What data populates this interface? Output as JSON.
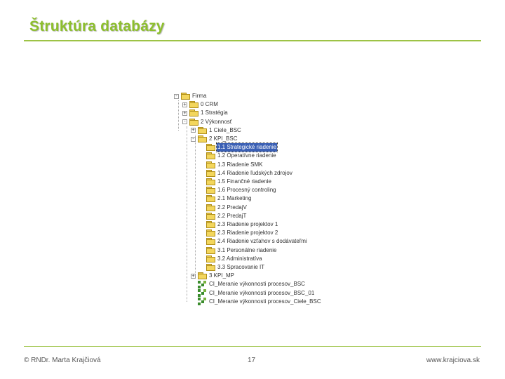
{
  "slide": {
    "title": "Štruktúra databázy",
    "footer_left": "© RNDr. Marta Krajčiová",
    "footer_page": "17",
    "footer_right": "www.krajciova.sk"
  },
  "tree": {
    "items": [
      {
        "label": "Firma",
        "expander": "-",
        "icon": "folder-icon"
      },
      {
        "label": "0 CRM",
        "expander": "+",
        "icon": "folder-icon"
      },
      {
        "label": "1 Stratégia",
        "expander": "+",
        "icon": "folder-icon"
      },
      {
        "label": "2 Výkonnosť",
        "expander": "-",
        "icon": "folder-icon"
      },
      {
        "label": "1 Ciele_BSC",
        "expander": "+",
        "icon": "folder-icon"
      },
      {
        "label": "2 KPI_BSC",
        "expander": "-",
        "icon": "folder-icon"
      },
      {
        "label": "1.1 Strategické riadenie",
        "expander": "",
        "icon": "folder-icon",
        "selected": true
      },
      {
        "label": "1.2 Operatívne riadenie",
        "expander": "",
        "icon": "folder-icon"
      },
      {
        "label": "1.3 Riadenie SMK",
        "expander": "",
        "icon": "folder-icon"
      },
      {
        "label": "1.4 Riadenie ľudských zdrojov",
        "expander": "",
        "icon": "folder-icon"
      },
      {
        "label": "1.5 Finančné riadenie",
        "expander": "",
        "icon": "folder-icon"
      },
      {
        "label": "1.6 Procesný controling",
        "expander": "",
        "icon": "folder-icon"
      },
      {
        "label": "2.1 Marketing",
        "expander": "",
        "icon": "folder-icon"
      },
      {
        "label": "2.2 PredajV",
        "expander": "",
        "icon": "folder-icon"
      },
      {
        "label": "2.2 PredajT",
        "expander": "",
        "icon": "folder-icon"
      },
      {
        "label": "2.3 Riadenie projektov 1",
        "expander": "",
        "icon": "folder-icon"
      },
      {
        "label": "2.3 Riadenie projektov 2",
        "expander": "",
        "icon": "folder-icon"
      },
      {
        "label": "2.4 Riadenie vzťahov s dodávateľmi",
        "expander": "",
        "icon": "folder-icon"
      },
      {
        "label": "3.1 Personálne riadenie",
        "expander": "",
        "icon": "folder-icon"
      },
      {
        "label": "3.2 Administratíva",
        "expander": "",
        "icon": "folder-icon"
      },
      {
        "label": "3.3 Spracovanie IT",
        "expander": "",
        "icon": "folder-icon"
      },
      {
        "label": "3 KPI_MP",
        "expander": "+",
        "icon": "folder-icon"
      },
      {
        "label": "CI_Meranie výkonnosti procesov_BSC",
        "expander": "",
        "icon": "report-icon"
      },
      {
        "label": "CI_Meranie výkonnosti procesov_BSC_01",
        "expander": "",
        "icon": "report-icon"
      },
      {
        "label": "CI_Meranie výkonnosti procesov_Ciele_BSC",
        "expander": "",
        "icon": "report-icon"
      }
    ]
  }
}
